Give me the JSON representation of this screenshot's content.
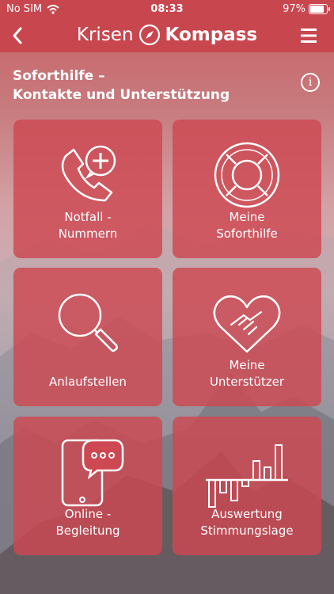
{
  "status": {
    "carrier": "No SIM",
    "time": "08:33",
    "battery": "97%"
  },
  "nav": {
    "brand_left": "Krisen",
    "brand_right": "Kompass"
  },
  "header": {
    "title_line1": "Soforthilfe –",
    "title_line2": "Kontakte und Unterstützung"
  },
  "tiles": [
    {
      "line1": "Notfall -",
      "line2": "Nummern",
      "icon": "phone-plus-icon"
    },
    {
      "line1": "Meine",
      "line2": "Soforthilfe",
      "icon": "lifebuoy-icon"
    },
    {
      "line1": "Anlaufstellen",
      "line2": "",
      "icon": "magnifier-icon"
    },
    {
      "line1": "Meine",
      "line2": "Unterstützer",
      "icon": "heart-handshake-icon"
    },
    {
      "line1": "Online -",
      "line2": "Begleitung",
      "icon": "tablet-chat-icon"
    },
    {
      "line1": "Auswertung",
      "line2": "Stimmungslage",
      "icon": "bar-chart-icon"
    }
  ],
  "colors": {
    "accent": "#c8474f",
    "tile": "#cd4852"
  }
}
